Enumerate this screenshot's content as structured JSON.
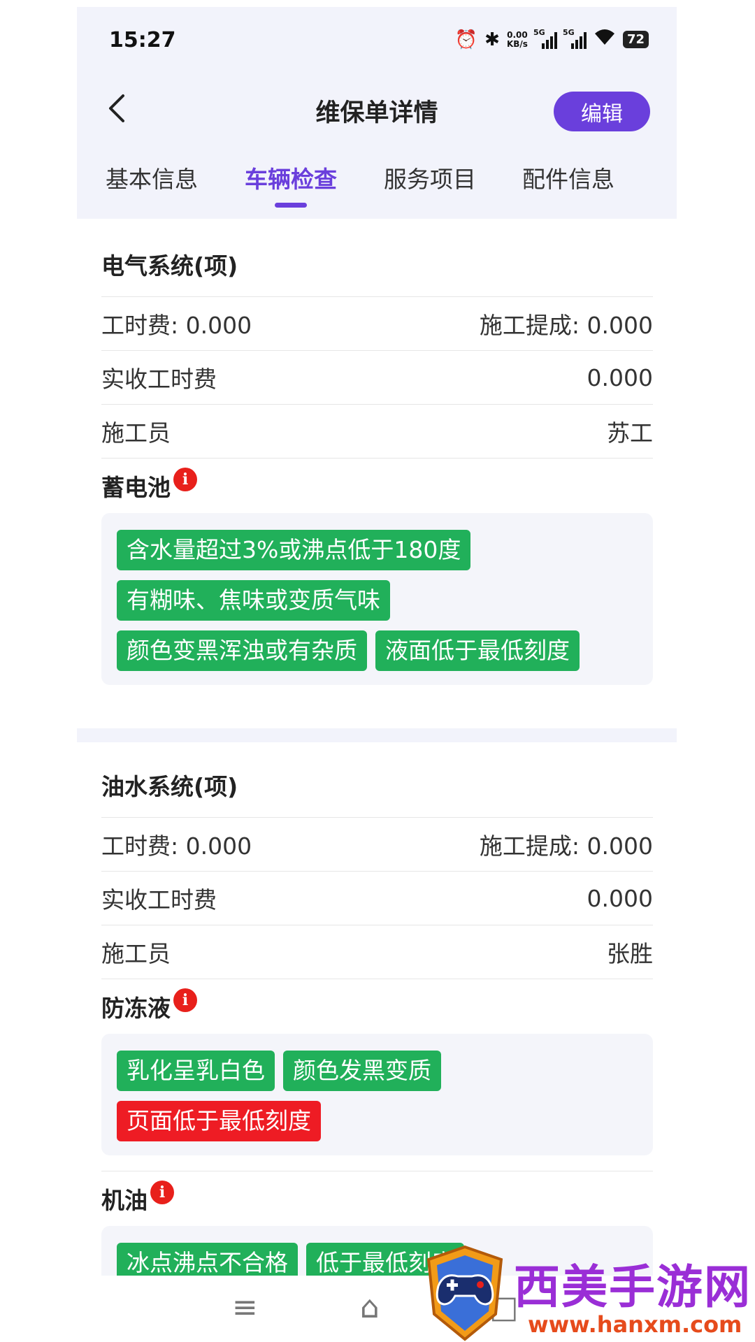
{
  "status_bar": {
    "time": "15:27",
    "net_speed_value": "0.00",
    "net_speed_unit": "KB/s",
    "signal1_label": "5G",
    "signal2_label": "5G",
    "battery": "72"
  },
  "header": {
    "title": "维保单详情",
    "edit_label": "编辑"
  },
  "tabs": [
    {
      "label": "基本信息",
      "active": false
    },
    {
      "label": "车辆检查",
      "active": true
    },
    {
      "label": "服务项目",
      "active": false
    },
    {
      "label": "配件信息",
      "active": false
    }
  ],
  "sections": [
    {
      "title": "电气系统(项)",
      "labor_fee_label": "工时费: 0.000",
      "commission_label": "施工提成: 0.000",
      "actual_fee_label": "实收工时费",
      "actual_fee_value": "0.000",
      "worker_label": "施工员",
      "worker_value": "苏工",
      "items": [
        {
          "name": "蓄电池",
          "tags": [
            {
              "text": "含水量超过3%或沸点低于180度",
              "color": "green"
            },
            {
              "text": "有糊味、焦味或变质气味",
              "color": "green"
            },
            {
              "text": "颜色变黑浑浊或有杂质",
              "color": "green"
            },
            {
              "text": "液面低于最低刻度",
              "color": "green"
            }
          ]
        }
      ]
    },
    {
      "title": "油水系统(项)",
      "labor_fee_label": "工时费: 0.000",
      "commission_label": "施工提成: 0.000",
      "actual_fee_label": "实收工时费",
      "actual_fee_value": "0.000",
      "worker_label": "施工员",
      "worker_value": "张胜",
      "items": [
        {
          "name": "防冻液",
          "tags": [
            {
              "text": "乳化呈乳白色",
              "color": "green"
            },
            {
              "text": "颜色发黑变质",
              "color": "green"
            },
            {
              "text": "页面低于最低刻度",
              "color": "red"
            }
          ]
        },
        {
          "name": "机油",
          "tags": [
            {
              "text": "冰点沸点不合格",
              "color": "green"
            },
            {
              "text": "低于最低刻度",
              "color": "green"
            }
          ]
        }
      ]
    }
  ],
  "watermark": {
    "brand": "西美手游网",
    "url": "www.hanxm.com"
  },
  "colors": {
    "accent": "#6a3fdc",
    "tag_green": "#21b05a",
    "tag_red": "#ee1c24",
    "info_red": "#e8201b"
  }
}
